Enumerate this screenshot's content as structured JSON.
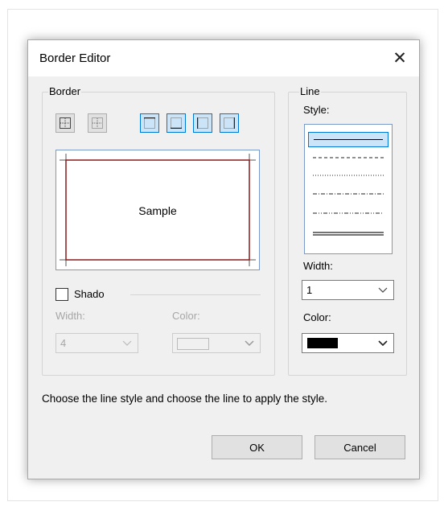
{
  "dialog": {
    "title": "Border Editor",
    "close_glyph": "✕"
  },
  "border_group": {
    "legend": "Border"
  },
  "preview": {
    "sample_text": "Sample"
  },
  "shadow": {
    "checkbox_label": "Shado",
    "checked": false,
    "width_label": "Width:",
    "width_value": "4",
    "color_label": "Color:"
  },
  "line_group": {
    "legend": "Line",
    "style_label": "Style:",
    "width_label": "Width:",
    "width_value": "1",
    "color_label": "Color:",
    "color_value": "#000000"
  },
  "help_text": "Choose the line style and choose the line to apply the style.",
  "buttons": {
    "ok": "OK",
    "cancel": "Cancel"
  },
  "colors": {
    "border_accent": "#8b1a1a",
    "selection": "#cce4f7",
    "focus": "#0078d7"
  }
}
